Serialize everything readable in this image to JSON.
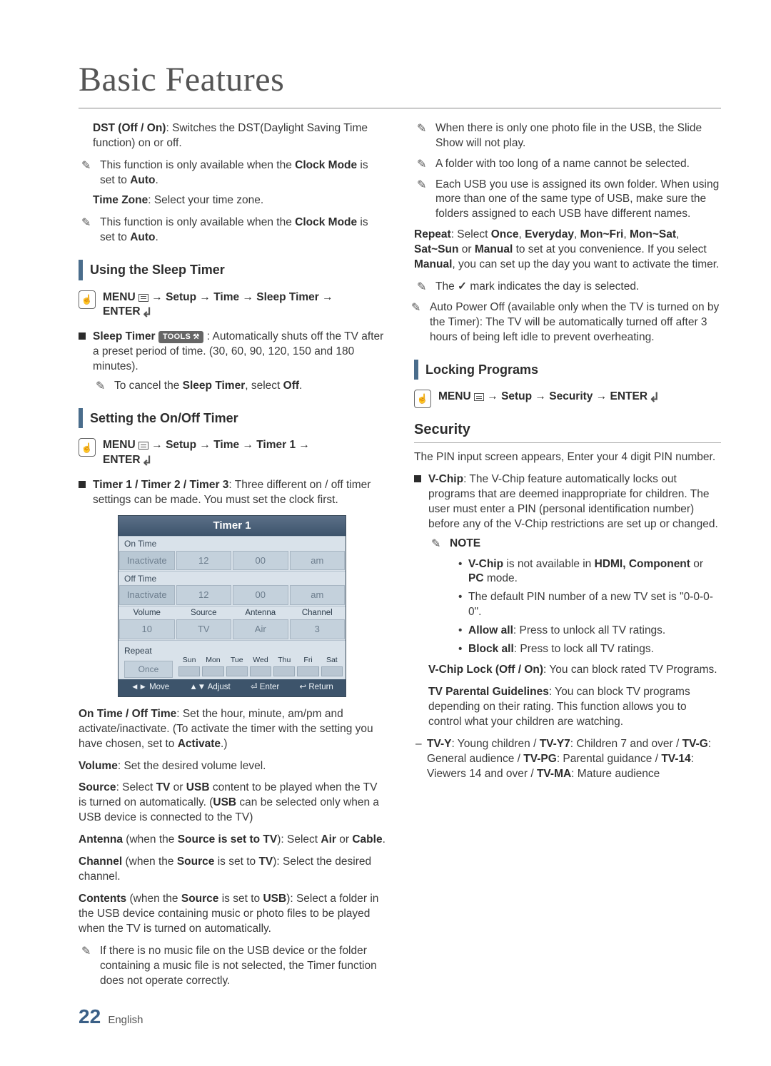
{
  "page_title": "Basic Features",
  "page_number": "22",
  "page_lang": "English",
  "left": {
    "dst_title": "DST (Off / On)",
    "dst_body": ": Switches the DST(Daylight Saving Time function) on or off.",
    "dst_note_pre": "This function is only available when the ",
    "dst_note_b1": "Clock Mode",
    "dst_note_mid": " is set to ",
    "dst_note_b2": "Auto",
    "dst_note_post": ".",
    "tz_title": "Time Zone",
    "tz_body": ": Select your time zone.",
    "tz_note_pre": "This function is only available when the ",
    "tz_note_b1": "Clock Mode",
    "tz_note_mid": " is set to ",
    "tz_note_b2": "Auto",
    "tz_note_post": ".",
    "sleep_heading": "Using the Sleep Timer",
    "sleep_path": "MENU → Setup → Time → Sleep Timer → ENTER",
    "sleep_path_menu": "MENU",
    "sleep_path_parts": {
      "a": " → Setup → Time → Sleep Timer → ",
      "enter": "ENTER"
    },
    "sleep_item_title": "Sleep Timer",
    "tools_label": "TOOLS",
    "sleep_item_body": " : Automatically shuts off the TV after a preset period of time. (30, 60, 90, 120, 150 and 180 minutes).",
    "sleep_item_note_pre": "To cancel the ",
    "sleep_item_note_b1": "Sleep Timer",
    "sleep_item_note_mid": ", select ",
    "sleep_item_note_b2": "Off",
    "sleep_item_note_post": ".",
    "onoff_heading": "Setting the On/Off Timer",
    "onoff_path_parts": {
      "menu": "MENU",
      "a": " → Setup → Time → Timer 1 → ",
      "enter": "ENTER"
    },
    "timers_title": "Timer 1 / Timer 2 / Timer 3",
    "timers_body": ": Three different on / off timer settings can be made. You must set the clock first.",
    "timer_ui": {
      "title": "Timer 1",
      "on_time_label": "On Time",
      "on_time": {
        "state": "Inactivate",
        "hour": "12",
        "min": "00",
        "ampm": "am"
      },
      "off_time_label": "Off Time",
      "off_time": {
        "state": "Inactivate",
        "hour": "12",
        "min": "00",
        "ampm": "am"
      },
      "labels": {
        "volume": "Volume",
        "source": "Source",
        "antenna": "Antenna",
        "channel": "Channel"
      },
      "values": {
        "volume": "10",
        "source": "TV",
        "antenna": "Air",
        "channel": "3"
      },
      "repeat_label": "Repeat",
      "repeat_value": "Once",
      "days": [
        "Sun",
        "Mon",
        "Tue",
        "Wed",
        "Thu",
        "Fri",
        "Sat"
      ],
      "footer": {
        "move": "◄► Move",
        "adjust": "▲▼ Adjust",
        "enter": "⏎ Enter",
        "return": "↩ Return"
      }
    },
    "ontime_title": "On Time / Off Time",
    "ontime_body_pre": ": Set the hour, minute, am/pm and activate/inactivate. (To activate the timer with the setting you have chosen, set to ",
    "ontime_body_b": "Activate",
    "ontime_body_post": ".)",
    "volume_title": "Volume",
    "volume_body": ": Set the desired volume level.",
    "source_title": "Source",
    "source_body_pre": ": Select ",
    "source_b1": "TV",
    "source_mid1": " or ",
    "source_b2": "USB",
    "source_body_mid": " content to be played when the TV is turned on automatically. (",
    "source_b3": "USB",
    "source_body_post": " can be selected only when a USB device is connected to the TV)",
    "antenna_title": "Antenna",
    "antenna_cond_pre": " (when the ",
    "antenna_cond_b": "Source is set to TV",
    "antenna_cond_post": "): Select ",
    "antenna_b1": "Air",
    "antenna_mid": " or ",
    "antenna_b2": "Cable",
    "antenna_post": ".",
    "channel_title": "Channel",
    "channel_cond_pre": " (when the ",
    "channel_cond_b": "Source",
    "channel_cond_mid": " is set to ",
    "channel_cond_b2": "TV",
    "channel_cond_post": "): Select the desired channel.",
    "contents_title": "Contents",
    "contents_cond_pre": " (when the ",
    "contents_cond_b": "Source",
    "contents_cond_mid": " is set to ",
    "contents_cond_b2": "USB",
    "contents_cond_post": "): Select a folder in the USB device containing music or photo files to be played when the TV is turned on automatically.",
    "contents_note": "If there is no music file on the USB device or the folder containing a music file is not selected, the Timer function does not operate correctly."
  },
  "right": {
    "note1": "When there is only one photo file in the USB, the Slide Show will not play.",
    "note2": "A folder with too long of a name cannot be selected.",
    "note3": "Each USB you use is assigned its own folder. When using more than one of the same type of USB, make sure the folders assigned to each USB have different names.",
    "repeat_title": "Repeat",
    "repeat_pre": ": Select ",
    "repeat_b1": "Once",
    "repeat_s1": ", ",
    "repeat_b2": "Everyday",
    "repeat_s2": ", ",
    "repeat_b3": "Mon~Fri",
    "repeat_s3": ", ",
    "repeat_b4": "Mon~Sat",
    "repeat_s4": ", ",
    "repeat_b5": "Sat~Sun",
    "repeat_mid": " or ",
    "repeat_b6": "Manual",
    "repeat_body": " to set at you convenience. If you select ",
    "repeat_b7": "Manual",
    "repeat_post": ", you can set up the day you want to activate the timer.",
    "repeat_note_pre": "The ",
    "repeat_note_check": "✓",
    "repeat_note_post": " mark indicates the day is selected.",
    "autopower_note": "Auto Power Off (available only when the TV is turned on by the Timer): The TV will be automatically turned off after 3 hours of being left idle to prevent overheating.",
    "locking_heading": "Locking Programs",
    "locking_path": {
      "menu": "MENU",
      "a": " → Setup → Security → ",
      "enter": "ENTER"
    },
    "security_heading": "Security",
    "pin_line": "The PIN input screen appears, Enter your 4 digit PIN number.",
    "vchip_title": "V-Chip",
    "vchip_body": ": The V-Chip feature automatically locks out programs that are deemed inappropriate for children. The user must enter a PIN (personal identification number) before any of the V-Chip restrictions are set up or changed.",
    "note_label": "NOTE",
    "vchip_n1_b": "V-Chip",
    "vchip_n1_pre": " is not available in ",
    "vchip_n1_b2": "HDMI, Component",
    "vchip_n1_mid": " or ",
    "vchip_n1_b3": "PC",
    "vchip_n1_post": " mode.",
    "vchip_n2": "The default PIN number of a new TV set is \"0-0-0-0\".",
    "vchip_n3_b": "Allow all",
    "vchip_n3_post": ": Press to unlock all TV ratings.",
    "vchip_n4_b": "Block all",
    "vchip_n4_post": ": Press to lock all TV ratings.",
    "vchiplock_title": "V-Chip Lock (Off / On)",
    "vchiplock_body": ": You can block rated TV Programs.",
    "tvpg_title": "TV Parental Guidelines",
    "tvpg_body": ": You can block TV programs depending on their rating. This function allows you to control what your children are watching.",
    "ratings_b1": "TV-Y",
    "ratings_t1": ": Young children / ",
    "ratings_b2": "TV-Y7",
    "ratings_t2": ": Children 7 and over / ",
    "ratings_b3": "TV-G",
    "ratings_t3": ": General audience / ",
    "ratings_b4": "TV-PG",
    "ratings_t4": ": Parental guidance / ",
    "ratings_b5": "TV-14",
    "ratings_t5": ": Viewers 14 and over / ",
    "ratings_b6": "TV-MA",
    "ratings_t6": ": Mature audience"
  }
}
